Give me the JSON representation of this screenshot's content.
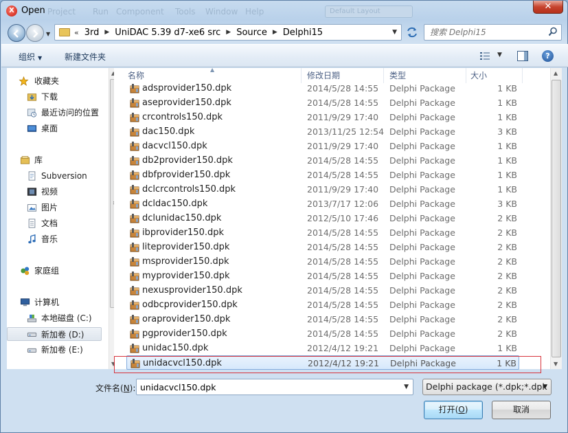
{
  "window": {
    "title": "Open",
    "app_icon_glyph": "X",
    "close_glyph": "✕",
    "background_menu": [
      "Project",
      "Run",
      "Component",
      "Tools",
      "Window",
      "Help"
    ],
    "background_combo": "Default Layout"
  },
  "address_bar": {
    "overflow_chevron": "«",
    "breadcrumbs": [
      "3rd",
      "UniDAC 5.39 d7-xe6 src",
      "Source",
      "Delphi15"
    ]
  },
  "search": {
    "placeholder": "搜索 Delphi15"
  },
  "toolbar": {
    "organize_label": "组织",
    "new_folder_label": "新建文件夹",
    "help_glyph": "?"
  },
  "navigation": {
    "favorites": {
      "label": "收藏夹",
      "items": [
        "下载",
        "最近访问的位置",
        "桌面"
      ]
    },
    "libraries": {
      "label": "库",
      "items": [
        "Subversion",
        "视频",
        "图片",
        "文档",
        "音乐"
      ]
    },
    "homegroup": {
      "label": "家庭组"
    },
    "computer": {
      "label": "计算机",
      "items": [
        "本地磁盘 (C:)",
        "新加卷 (D:)",
        "新加卷 (E:)"
      ],
      "selected": "新加卷 (D:)"
    }
  },
  "file_list": {
    "columns": [
      "名称",
      "修改日期",
      "类型",
      "大小"
    ],
    "files": [
      {
        "name": "adsprovider150.dpk",
        "date": "2014/5/28 14:55",
        "type": "Delphi Package",
        "size": "1 KB"
      },
      {
        "name": "aseprovider150.dpk",
        "date": "2014/5/28 14:55",
        "type": "Delphi Package",
        "size": "1 KB"
      },
      {
        "name": "crcontrols150.dpk",
        "date": "2011/9/29 17:40",
        "type": "Delphi Package",
        "size": "1 KB"
      },
      {
        "name": "dac150.dpk",
        "date": "2013/11/25 12:54",
        "type": "Delphi Package",
        "size": "3 KB"
      },
      {
        "name": "dacvcl150.dpk",
        "date": "2011/9/29 17:40",
        "type": "Delphi Package",
        "size": "1 KB"
      },
      {
        "name": "db2provider150.dpk",
        "date": "2014/5/28 14:55",
        "type": "Delphi Package",
        "size": "1 KB"
      },
      {
        "name": "dbfprovider150.dpk",
        "date": "2014/5/28 14:55",
        "type": "Delphi Package",
        "size": "1 KB"
      },
      {
        "name": "dclcrcontrols150.dpk",
        "date": "2011/9/29 17:40",
        "type": "Delphi Package",
        "size": "1 KB"
      },
      {
        "name": "dcldac150.dpk",
        "date": "2013/7/17 12:06",
        "type": "Delphi Package",
        "size": "3 KB"
      },
      {
        "name": "dclunidac150.dpk",
        "date": "2012/5/10 17:46",
        "type": "Delphi Package",
        "size": "2 KB"
      },
      {
        "name": "ibprovider150.dpk",
        "date": "2014/5/28 14:55",
        "type": "Delphi Package",
        "size": "2 KB"
      },
      {
        "name": "liteprovider150.dpk",
        "date": "2014/5/28 14:55",
        "type": "Delphi Package",
        "size": "2 KB"
      },
      {
        "name": "msprovider150.dpk",
        "date": "2014/5/28 14:55",
        "type": "Delphi Package",
        "size": "2 KB"
      },
      {
        "name": "myprovider150.dpk",
        "date": "2014/5/28 14:55",
        "type": "Delphi Package",
        "size": "2 KB"
      },
      {
        "name": "nexusprovider150.dpk",
        "date": "2014/5/28 14:55",
        "type": "Delphi Package",
        "size": "2 KB"
      },
      {
        "name": "odbcprovider150.dpk",
        "date": "2014/5/28 14:55",
        "type": "Delphi Package",
        "size": "2 KB"
      },
      {
        "name": "oraprovider150.dpk",
        "date": "2014/5/28 14:55",
        "type": "Delphi Package",
        "size": "2 KB"
      },
      {
        "name": "pgprovider150.dpk",
        "date": "2014/5/28 14:55",
        "type": "Delphi Package",
        "size": "2 KB"
      },
      {
        "name": "unidac150.dpk",
        "date": "2012/4/12 19:21",
        "type": "Delphi Package",
        "size": "1 KB"
      },
      {
        "name": "unidacvcl150.dpk",
        "date": "2012/4/12 19:21",
        "type": "Delphi Package",
        "size": "1 KB",
        "selected": true
      }
    ]
  },
  "footer": {
    "filename_label": "文件名(",
    "filename_accel": "N",
    "filename_label_end": "):",
    "filename_value": "unidacvcl150.dpk",
    "filter_value": "Delphi package (*.dpk;*.dpk",
    "open_label": "打开(",
    "open_accel": "O",
    "open_label_end": ")",
    "cancel_label": "取消"
  },
  "colors": {
    "selection_outline": "#d8343c",
    "selected_row": "#d6e8fc"
  }
}
